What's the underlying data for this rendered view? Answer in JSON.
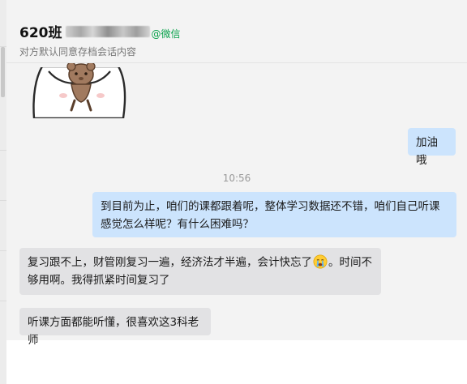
{
  "header": {
    "title": "620班",
    "tag": "@微信",
    "subtitle": "对方默认同意存档会话内容"
  },
  "messages": [
    {
      "side": "right",
      "text": "加油哦"
    },
    {
      "side": "time",
      "text": "10:56"
    },
    {
      "side": "right",
      "text": "到目前为止，咱们的课都跟着呢，整体学习数据还不错，咱们自己听课感觉怎么样呢？有什么困难吗？"
    },
    {
      "side": "left",
      "text_before": "复习跟不上，财管刚复习一遍，经济法才半遍，会计快忘了",
      "emoji": "crying-face",
      "text_after": "。时间不够用啊。我得抓紧时间复习了"
    },
    {
      "side": "left",
      "text": "听课方面都能听懂，很喜欢这3科老师"
    }
  ],
  "colors": {
    "chat_bg": "#f3f3f3",
    "bubble_self": "#cce4fd",
    "bubble_other": "#e2e2e4",
    "wechat_green": "#07a14a"
  }
}
